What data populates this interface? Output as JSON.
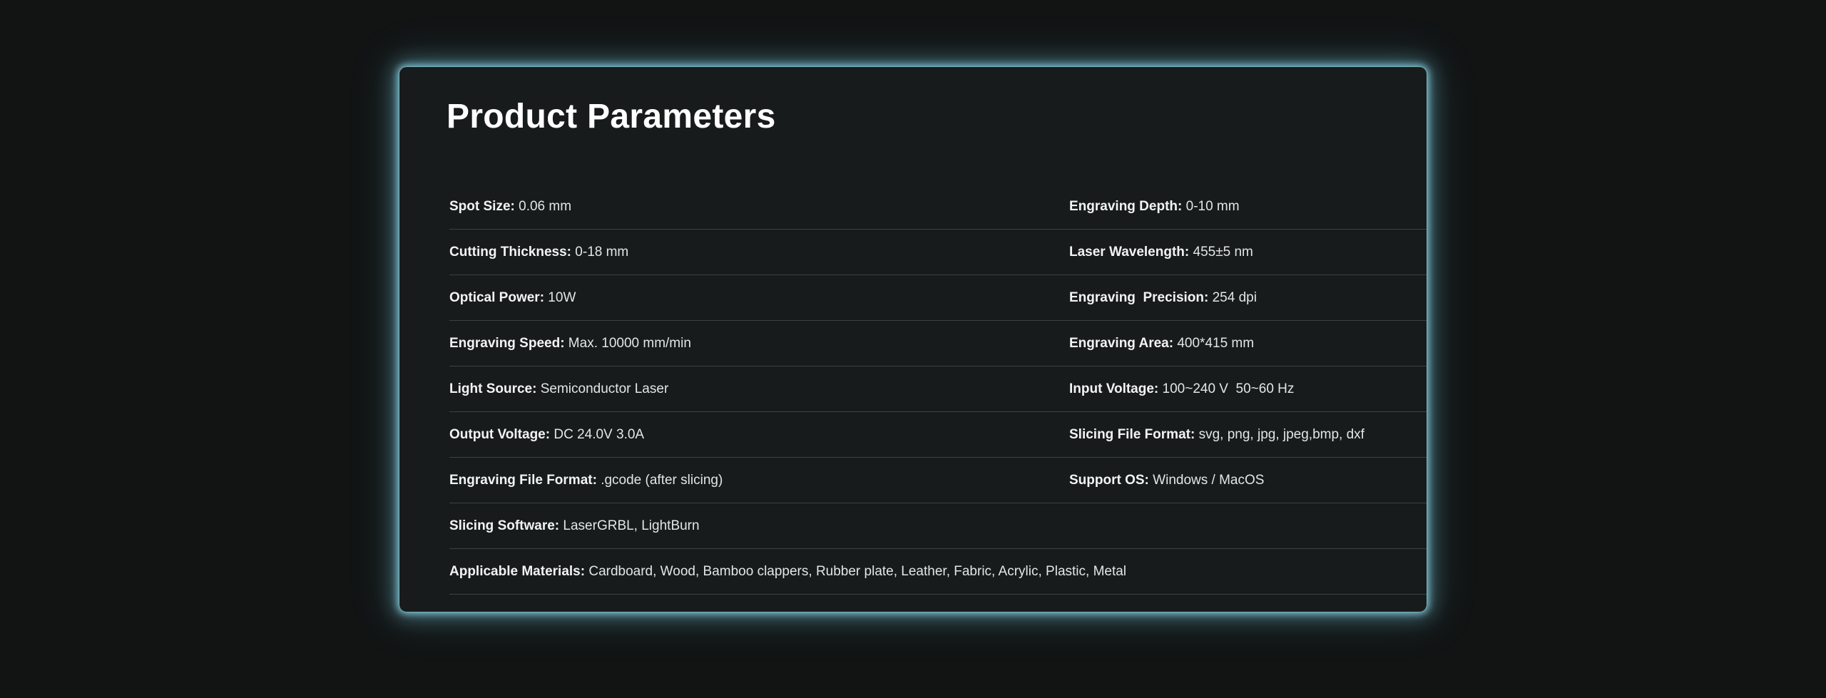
{
  "title": "Product Parameters",
  "rows": [
    {
      "left": {
        "label": "Spot Size:",
        "value": " 0.06 mm"
      },
      "right": {
        "label": "Engraving Depth:",
        "value": " 0-10 mm"
      }
    },
    {
      "left": {
        "label": "Cutting Thickness:",
        "value": " 0-18 mm"
      },
      "right": {
        "label": "Laser Wavelength:",
        "value": " 455±5 nm"
      }
    },
    {
      "left": {
        "label": "Optical Power:",
        "value": " 10W"
      },
      "right": {
        "label": "Engraving  Precision:",
        "value": " 254 dpi"
      }
    },
    {
      "left": {
        "label": "Engraving Speed:",
        "value": " Max. 10000 mm/min"
      },
      "right": {
        "label": "Engraving Area:",
        "value": " 400*415 mm"
      }
    },
    {
      "left": {
        "label": "Light Source:",
        "value": " Semiconductor Laser"
      },
      "right": {
        "label": "Input Voltage:",
        "value": " 100~240 V  50~60 Hz"
      }
    },
    {
      "left": {
        "label": "Output Voltage:",
        "value": " DC 24.0V 3.0A"
      },
      "right": {
        "label": "Slicing File Format:",
        "value": " svg, png, jpg, jpeg,bmp, dxf"
      }
    },
    {
      "left": {
        "label": "Engraving File Format:",
        "value": " .gcode (after slicing)"
      },
      "right": {
        "label": "Support OS:",
        "value": " Windows / MacOS"
      }
    }
  ],
  "full_rows": [
    {
      "label": "Slicing Software:",
      "value": " LaserGRBL, LightBurn"
    },
    {
      "label": "Applicable Materials:",
      "value": " Cardboard, Wood, Bamboo clappers, Rubber plate, Leather, Fabric, Acrylic, Plastic, Metal"
    }
  ],
  "colors": {
    "background": "#121414",
    "card": "#181b1c",
    "glow": "#88cede",
    "divider": "#3b4142",
    "text": "#e3e6e6"
  }
}
